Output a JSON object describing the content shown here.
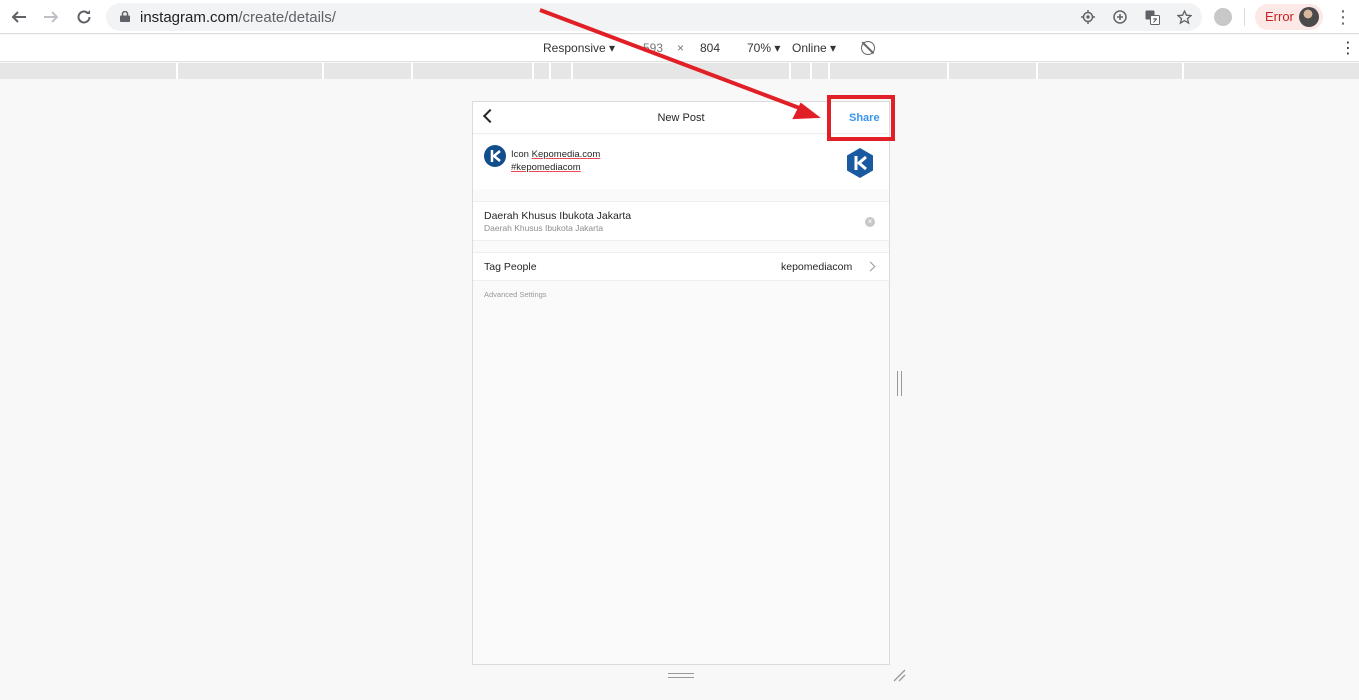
{
  "browser": {
    "url_host": "instagram.com",
    "url_path": "/create/details/",
    "error_label": "Error",
    "icons": [
      "back-icon",
      "forward-icon",
      "reload-icon",
      "lock-icon",
      "location-icon",
      "zoom-icon",
      "translate-icon",
      "star-icon",
      "extension-icon",
      "avatar",
      "menu-icon"
    ]
  },
  "device_toolbar": {
    "device": "Responsive",
    "width": "593",
    "height": "804",
    "times": "×",
    "zoom": "70%",
    "network": "Online"
  },
  "app": {
    "title": "New Post",
    "share_label": "Share",
    "caption_line1_prefix": "Icon ",
    "caption_line1_link": "Kepomedia.com",
    "caption_line2": "#kepomediacom",
    "location_title": "Daerah Khusus Ibukota Jakarta",
    "location_subtitle": "Daerah Khusus Ibukota Jakarta",
    "tag_label": "Tag People",
    "tag_value": "kepomediacom",
    "advanced_settings": "Advanced Settings"
  },
  "colors": {
    "share_blue": "#3897f0",
    "annotation_red": "#e11f26",
    "logo_blue": "#134e8c"
  }
}
